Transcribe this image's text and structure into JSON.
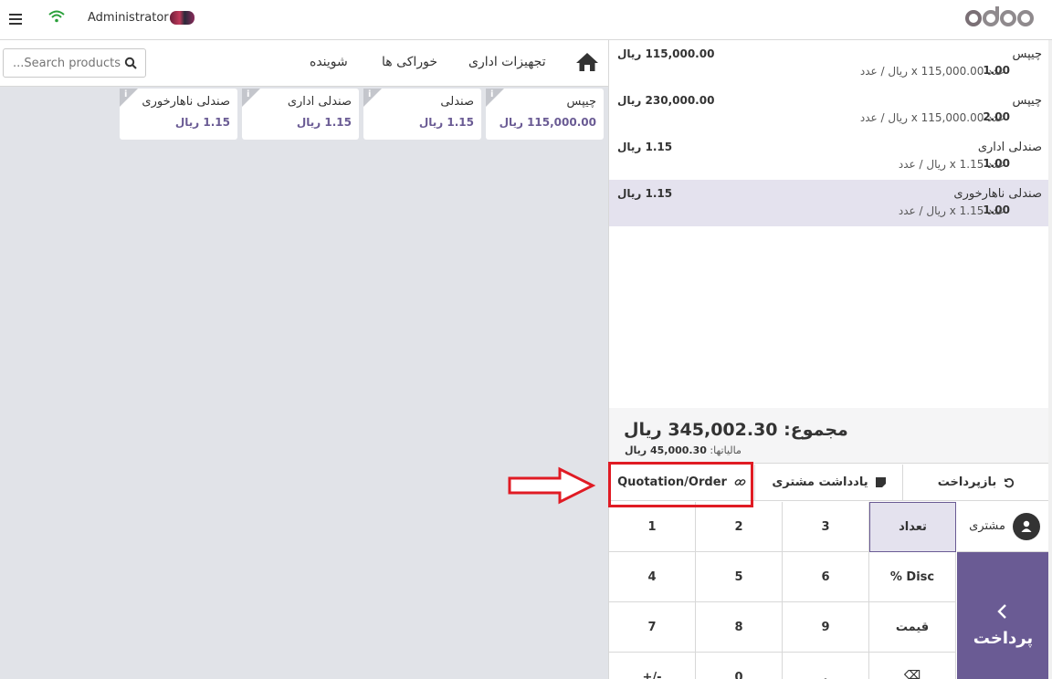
{
  "header": {
    "user_name": "Administrator",
    "logo_text": "odoo"
  },
  "products_panel": {
    "search": {
      "placeholder": "Search products..."
    },
    "categories": [
      "تجهیزات اداری",
      "خوراکی ها",
      "شوینده"
    ],
    "products": [
      {
        "name": "چیپس",
        "price": "115,000.00 ریال"
      },
      {
        "name": "صندلی",
        "price": "1.15 ریال"
      },
      {
        "name": "صندلی اداری",
        "price": "1.15 ریال"
      },
      {
        "name": "صندلی ناهارخوری",
        "price": "1.15 ریال"
      }
    ],
    "info_glyph": "i"
  },
  "order": {
    "lines": [
      {
        "name": "چیپس",
        "qty": "1.00",
        "detail": "عدد 115,000.00 x ریال / عدد",
        "price": "115,000.00 ریال",
        "selected": false
      },
      {
        "name": "چیپس",
        "qty": "2.00",
        "detail": "عدد 115,000.00 x ریال / عدد",
        "price": "230,000.00 ریال",
        "selected": false
      },
      {
        "name": "صندلی اداری",
        "qty": "1.00",
        "detail": "عدد 1.15 x ریال / عدد",
        "price": "1.15 ریال",
        "selected": false
      },
      {
        "name": "صندلی ناهارخوری",
        "qty": "1.00",
        "detail": "عدد 1.15 x ریال / عدد",
        "price": "1.15 ریال",
        "selected": true
      }
    ],
    "total_label": "مجموع:",
    "total_value": "345,002.30 ریال",
    "tax_label": "مالیاتها:",
    "tax_value": "45,000.30 ریال"
  },
  "controls": {
    "refund_label": "بازپرداخت",
    "customer_note_label": "یادداشت مشتری",
    "quotation_label": "Quotation/Order"
  },
  "numpad": {
    "keys": [
      "1",
      "2",
      "3",
      "4",
      "5",
      "6",
      "7",
      "8",
      "9",
      "+/-",
      "0",
      "."
    ],
    "mode_qty": "تعداد",
    "mode_disc": "% Disc",
    "mode_price": "قیمت",
    "backspace": "⌫",
    "customer_label": "مشتری",
    "payment_label": "پرداخت"
  },
  "colors": {
    "accent": "#6a5b94",
    "selected_row": "#e4e2ee",
    "highlight": "#e01b24",
    "product_bg": "#e1e3e8"
  }
}
